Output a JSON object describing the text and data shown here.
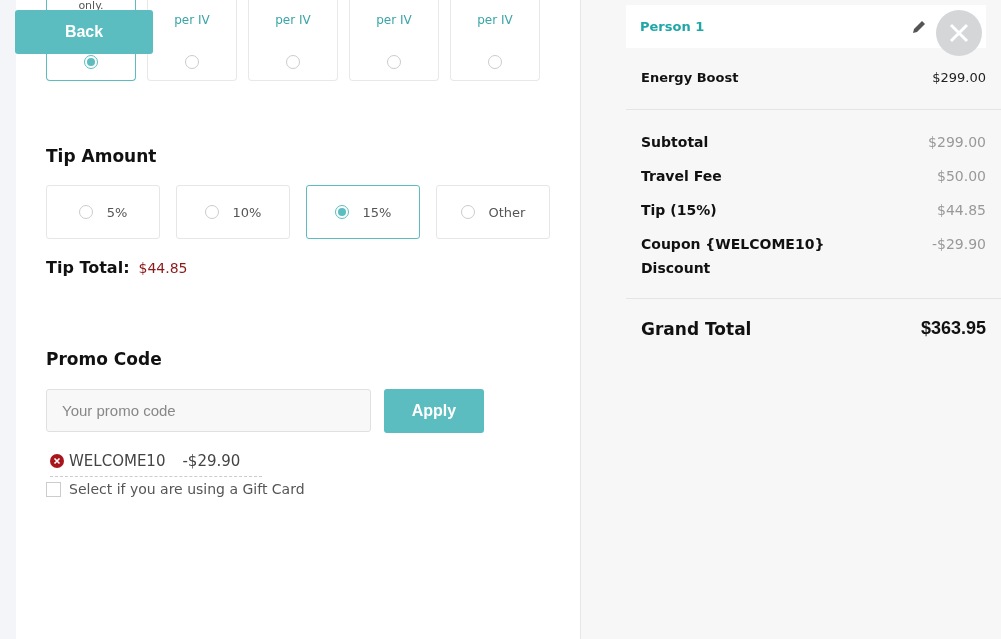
{
  "back_button": "Back",
  "plans": [
    {
      "label": "only.",
      "selected": true
    },
    {
      "label": "per IV",
      "selected": false
    },
    {
      "label": "per IV",
      "selected": false
    },
    {
      "label": "per IV",
      "selected": false
    },
    {
      "label": "per IV",
      "selected": false
    }
  ],
  "tip": {
    "title": "Tip Amount",
    "options": [
      {
        "label": "5%",
        "selected": false
      },
      {
        "label": "10%",
        "selected": false
      },
      {
        "label": "15%",
        "selected": true
      },
      {
        "label": "Other",
        "selected": false
      }
    ],
    "total_label": "Tip Total:",
    "total_value": "$44.85"
  },
  "promo": {
    "title": "Promo Code",
    "placeholder": "Your promo code",
    "apply_button": "Apply",
    "applied_code": "WELCOME10",
    "applied_amount": "-$29.90",
    "gift_card": {
      "label": "Select if you are using a Gift Card",
      "checked": false
    }
  },
  "summary": {
    "person": "Person 1",
    "items": [
      {
        "name": "Energy Boost",
        "price": "$299.00"
      }
    ],
    "lines": [
      {
        "label": "Subtotal",
        "value": "$299.00"
      },
      {
        "label": "Travel Fee",
        "value": "$50.00"
      },
      {
        "label": "Tip (15%)",
        "value": "$44.85"
      },
      {
        "label": "Coupon {WELCOME10} Discount",
        "value": "-$29.90"
      }
    ],
    "grand_total": {
      "label": "Grand Total",
      "value": "$363.95"
    }
  }
}
